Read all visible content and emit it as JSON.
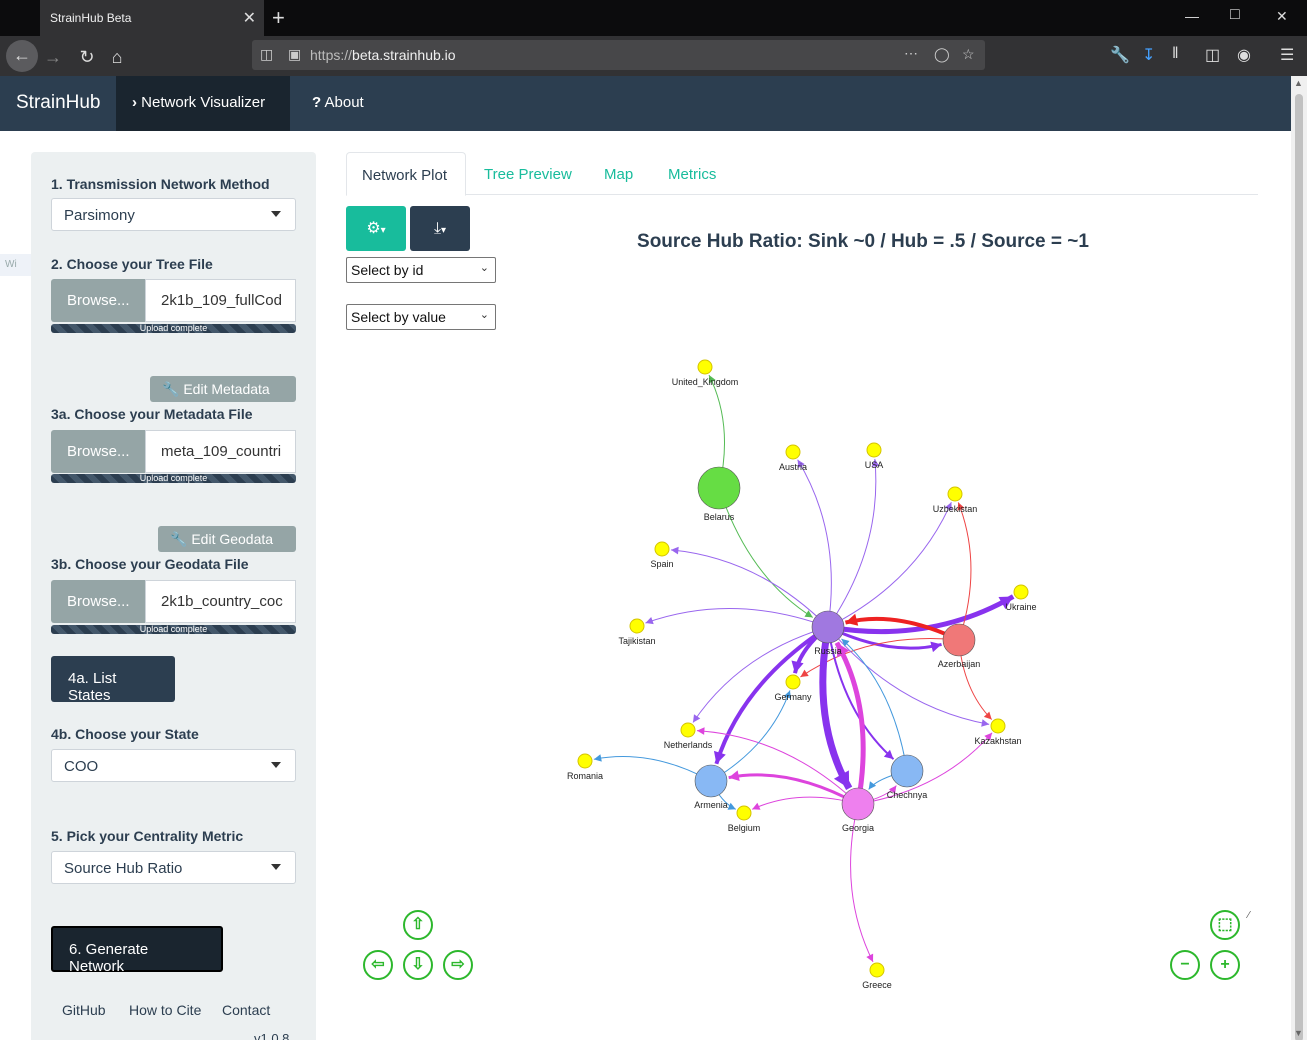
{
  "browser": {
    "tab_title": "StrainHub Beta",
    "url_scheme": "https://",
    "url_host": "beta.strainhub.io",
    "min": "—",
    "max": "□",
    "close": "✕"
  },
  "app": {
    "brand": "StrainHub",
    "nav": [
      {
        "label": "Network Visualizer",
        "icon": "›"
      },
      {
        "label": "About",
        "icon": "?"
      }
    ]
  },
  "sidebar": {
    "ghost_text": "Wi",
    "s1_label": "1. Transmission Network Method",
    "s1_value": "Parsimony",
    "s2_label": "2. Choose your Tree File",
    "browse": "Browse...",
    "s2_file": "2k1b_109_fullCod",
    "upload_complete": "Upload complete",
    "edit_metadata": "Edit Metadata",
    "s3a_label": "3a. Choose your Metadata File",
    "s3a_file": "meta_109_countri",
    "edit_geodata": "Edit Geodata",
    "s3b_label": "3b. Choose your Geodata File",
    "s3b_file": "2k1b_country_coc",
    "list_states": "4a. List States",
    "s4b_label": "4b. Choose your State",
    "s4b_value": "COO",
    "s5_label": "5. Pick your Centrality Metric",
    "s5_value": "Source Hub Ratio",
    "generate": "6. Generate Network",
    "footer_links": [
      "GitHub",
      "How to Cite",
      "Contact"
    ],
    "version": "v1.0.8"
  },
  "main": {
    "tabs": [
      "Network Plot",
      "Tree Preview",
      "Map",
      "Metrics"
    ],
    "active_tab": "Network Plot",
    "select_id": "Select by id",
    "select_value": "Select by value",
    "title": "Source Hub Ratio: Sink ~0 / Hub = .5 / Source = ~1"
  },
  "network": {
    "colors": {
      "yellow": "#ffff00",
      "purple": "#a078e0",
      "red": "#f07878",
      "green": "#66dd44",
      "blue": "#88b8f4",
      "pink": "#ee80ee"
    },
    "nodes": [
      {
        "id": "United_Kingdom",
        "label": "United_Kingdom",
        "size": "small",
        "color": "yellow"
      },
      {
        "id": "Austria",
        "label": "Austria",
        "size": "small",
        "color": "yellow"
      },
      {
        "id": "USA",
        "label": "USA",
        "size": "small",
        "color": "yellow"
      },
      {
        "id": "Uzbekistan",
        "label": "Uzbekistan",
        "size": "small",
        "color": "yellow"
      },
      {
        "id": "Belarus",
        "label": "Belarus",
        "size": "large",
        "color": "green"
      },
      {
        "id": "Spain",
        "label": "Spain",
        "size": "small",
        "color": "yellow"
      },
      {
        "id": "Ukraine",
        "label": "Ukraine",
        "size": "small",
        "color": "yellow"
      },
      {
        "id": "Tajikistan",
        "label": "Tajikistan",
        "size": "small",
        "color": "yellow"
      },
      {
        "id": "Russia",
        "label": "Russia",
        "size": "medium",
        "color": "purple"
      },
      {
        "id": "Azerbaijan",
        "label": "Azerbaijan",
        "size": "medium",
        "color": "red"
      },
      {
        "id": "Germany",
        "label": "Germany",
        "size": "small",
        "color": "yellow"
      },
      {
        "id": "Kazakhstan",
        "label": "Kazakhstan",
        "size": "small",
        "color": "yellow"
      },
      {
        "id": "Netherlands",
        "label": "Netherlands",
        "size": "small",
        "color": "yellow"
      },
      {
        "id": "Romania",
        "label": "Romania",
        "size": "small",
        "color": "yellow"
      },
      {
        "id": "Armenia",
        "label": "Armenia",
        "size": "medium",
        "color": "blue"
      },
      {
        "id": "Chechnya",
        "label": "Chechnya",
        "size": "medium",
        "color": "blue"
      },
      {
        "id": "Belgium",
        "label": "Belgium",
        "size": "small",
        "color": "yellow"
      },
      {
        "id": "Georgia",
        "label": "Georgia",
        "size": "medium",
        "color": "pink"
      },
      {
        "id": "Greece",
        "label": "Greece",
        "size": "small",
        "color": "yellow"
      }
    ],
    "edges": [
      {
        "from": "Belarus",
        "to": "United_Kingdom",
        "color": "#55bb55",
        "weight": 1
      },
      {
        "from": "Belarus",
        "to": "Russia",
        "color": "#55bb55",
        "weight": 1
      },
      {
        "from": "Russia",
        "to": "Austria",
        "color": "#9966ee",
        "weight": 1
      },
      {
        "from": "Russia",
        "to": "USA",
        "color": "#9966ee",
        "weight": 1
      },
      {
        "from": "Russia",
        "to": "Spain",
        "color": "#9966ee",
        "weight": 1
      },
      {
        "from": "Russia",
        "to": "Tajikistan",
        "color": "#9966ee",
        "weight": 1
      },
      {
        "from": "Russia",
        "to": "Ukraine",
        "color": "#8833ee",
        "weight": 5
      },
      {
        "from": "Russia",
        "to": "Uzbekistan",
        "color": "#9966ee",
        "weight": 1
      },
      {
        "from": "Russia",
        "to": "Azerbaijan",
        "color": "#8833ee",
        "weight": 3
      },
      {
        "from": "Azerbaijan",
        "to": "Russia",
        "color": "#ee2222",
        "weight": 4
      },
      {
        "from": "Azerbaijan",
        "to": "Uzbekistan",
        "color": "#ee4444",
        "weight": 1
      },
      {
        "from": "Azerbaijan",
        "to": "Kazakhstan",
        "color": "#ee4444",
        "weight": 1
      },
      {
        "from": "Azerbaijan",
        "to": "Germany",
        "color": "#ee4444",
        "weight": 1
      },
      {
        "from": "Russia",
        "to": "Germany",
        "color": "#8833ee",
        "weight": 4
      },
      {
        "from": "Russia",
        "to": "Georgia",
        "color": "#8833ee",
        "weight": 7
      },
      {
        "from": "Russia",
        "to": "Armenia",
        "color": "#8833ee",
        "weight": 4
      },
      {
        "from": "Russia",
        "to": "Chechnya",
        "color": "#8833ee",
        "weight": 2
      },
      {
        "from": "Russia",
        "to": "Netherlands",
        "color": "#9966ee",
        "weight": 1
      },
      {
        "from": "Russia",
        "to": "Kazakhstan",
        "color": "#9966ee",
        "weight": 1
      },
      {
        "from": "Georgia",
        "to": "Russia",
        "color": "#dd44dd",
        "weight": 5
      },
      {
        "from": "Georgia",
        "to": "Armenia",
        "color": "#dd44dd",
        "weight": 3
      },
      {
        "from": "Georgia",
        "to": "Greece",
        "color": "#dd44dd",
        "weight": 1
      },
      {
        "from": "Georgia",
        "to": "Belgium",
        "color": "#dd44dd",
        "weight": 1
      },
      {
        "from": "Georgia",
        "to": "Netherlands",
        "color": "#dd44dd",
        "weight": 1
      },
      {
        "from": "Georgia",
        "to": "Kazakhstan",
        "color": "#dd44dd",
        "weight": 1
      },
      {
        "from": "Georgia",
        "to": "Chechnya",
        "color": "#dd44dd",
        "weight": 1
      },
      {
        "from": "Armenia",
        "to": "Romania",
        "color": "#4499dd",
        "weight": 1
      },
      {
        "from": "Armenia",
        "to": "Germany",
        "color": "#4499dd",
        "weight": 1
      },
      {
        "from": "Chechnya",
        "to": "Russia",
        "color": "#4499dd",
        "weight": 1
      },
      {
        "from": "Chechnya",
        "to": "Georgia",
        "color": "#4499dd",
        "weight": 1
      },
      {
        "from": "Armenia",
        "to": "Belgium",
        "color": "#4499dd",
        "weight": 1
      }
    ]
  },
  "controls": {
    "up": "⇧",
    "down": "⇩",
    "left": "⇦",
    "right": "⇨",
    "fit": "⬚",
    "zoom_out": "−",
    "zoom_in": "+"
  }
}
